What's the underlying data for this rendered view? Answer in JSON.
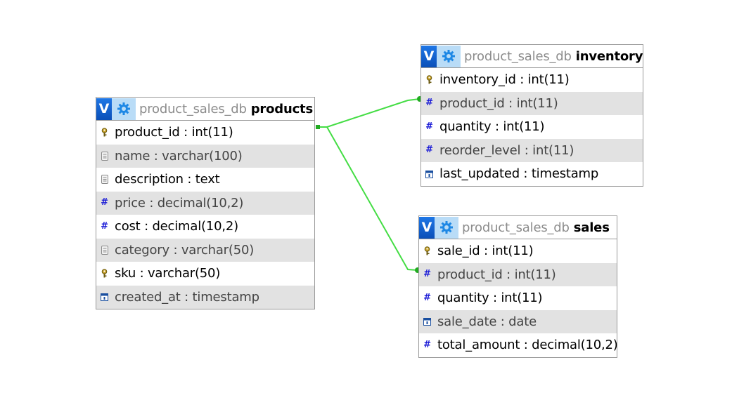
{
  "tables": {
    "products": {
      "db": "product_sales_db",
      "name": "products",
      "columns": [
        {
          "label": "product_id : int(11)",
          "icon": "key-icon"
        },
        {
          "label": "name : varchar(100)",
          "icon": "text-type-icon"
        },
        {
          "label": "description : text",
          "icon": "text-type-icon"
        },
        {
          "label": "price : decimal(10,2)",
          "icon": "numeric-type-icon"
        },
        {
          "label": "cost : decimal(10,2)",
          "icon": "numeric-type-icon"
        },
        {
          "label": "category : varchar(50)",
          "icon": "text-type-icon"
        },
        {
          "label": "sku : varchar(50)",
          "icon": "key-icon"
        },
        {
          "label": "created_at : timestamp",
          "icon": "date-type-icon"
        }
      ]
    },
    "inventory": {
      "db": "product_sales_db",
      "name": "inventory",
      "columns": [
        {
          "label": "inventory_id : int(11)",
          "icon": "key-icon"
        },
        {
          "label": "product_id : int(11)",
          "icon": "numeric-type-icon"
        },
        {
          "label": "quantity : int(11)",
          "icon": "numeric-type-icon"
        },
        {
          "label": "reorder_level : int(11)",
          "icon": "numeric-type-icon"
        },
        {
          "label": "last_updated : timestamp",
          "icon": "date-type-icon"
        }
      ]
    },
    "sales": {
      "db": "product_sales_db",
      "name": "sales",
      "columns": [
        {
          "label": "sale_id : int(11)",
          "icon": "key-icon"
        },
        {
          "label": "product_id : int(11)",
          "icon": "numeric-type-icon"
        },
        {
          "label": "quantity : int(11)",
          "icon": "numeric-type-icon"
        },
        {
          "label": "sale_date : date",
          "icon": "date-type-icon"
        },
        {
          "label": "total_amount : decimal(10,2)",
          "icon": "numeric-type-icon"
        }
      ]
    }
  },
  "header_buttons": {
    "toggle_label": "V",
    "toggle_icon": "toggle-icon",
    "options_icon": "gear-icon"
  },
  "relations": [
    {
      "from": "products.product_id",
      "to": "inventory.product_id"
    },
    {
      "from": "products.product_id",
      "to": "sales.product_id"
    }
  ],
  "colors": {
    "relation_line": "#44dd44",
    "toggle_button": "#1565d8",
    "options_button": "#b9dcf7",
    "alt_row": "#e2e2e2",
    "border": "#9a9a9a",
    "db_text": "#8c8c8c",
    "numeric_icon": "#1a1ad6"
  }
}
